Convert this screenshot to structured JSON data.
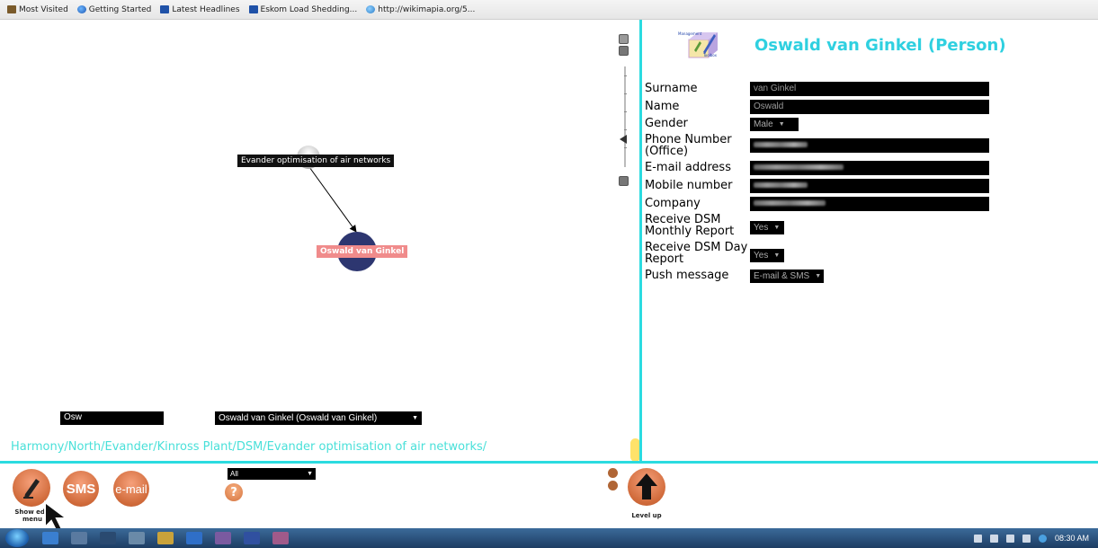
{
  "bookmarks": [
    {
      "label": "Most Visited",
      "icon": "folder-icon"
    },
    {
      "label": "Getting Started",
      "icon": "firefox-icon"
    },
    {
      "label": "Latest Headlines",
      "icon": "rss-icon"
    },
    {
      "label": "Eskom Load Shedding...",
      "icon": "folder-icon"
    },
    {
      "label": "http://wikimapia.org/5...",
      "icon": "globe-icon"
    }
  ],
  "graph": {
    "parent_node_label": "Evander optimisation of air networks",
    "selected_node_label": "Oswald van Ginkel",
    "search_value": "Osw",
    "person_select_value": "Oswald van Ginkel (Oswald van Ginkel)",
    "breadcrumb": "Harmony/North/Evander/Kinross Plant/DSM/Evander optimisation of air networks/"
  },
  "form": {
    "title": "Oswald van Ginkel (Person)",
    "logo_text": "Management Toolbox",
    "fields": {
      "surname": {
        "label": "Surname",
        "value": "van Ginkel"
      },
      "name": {
        "label": "Name",
        "value": "Oswald"
      },
      "gender": {
        "label": "Gender",
        "value": "Male"
      },
      "phone_line1": "Phone Number",
      "phone_line2": "(Office)",
      "email": {
        "label": "E-mail address"
      },
      "mobile": {
        "label": "Mobile number"
      },
      "company": {
        "label": "Company"
      },
      "monthly_line1": "Receive DSM",
      "monthly_line2": "Monthly Report",
      "monthly_value": "Yes",
      "day_line1": "Receive DSM Day",
      "day_line2": "Report",
      "day_value": "Yes",
      "push": {
        "label": "Push message",
        "value": "E-mail & SMS"
      }
    }
  },
  "toolbar": {
    "edit_caption_line1": "Show edit",
    "edit_caption_line2": "menu",
    "sms_label": "SMS",
    "email_label": "e-mail",
    "filter_value": "All",
    "help_label": "?",
    "levelup_caption": "Level up"
  },
  "taskbar": {
    "clock": "08:30 AM"
  },
  "colors": {
    "accent": "#2bdbe0",
    "title": "#2fd0e0",
    "button_orange": "#d06a3a",
    "node_navy": "#2d3670",
    "node_label_pink": "#f08b8b"
  }
}
